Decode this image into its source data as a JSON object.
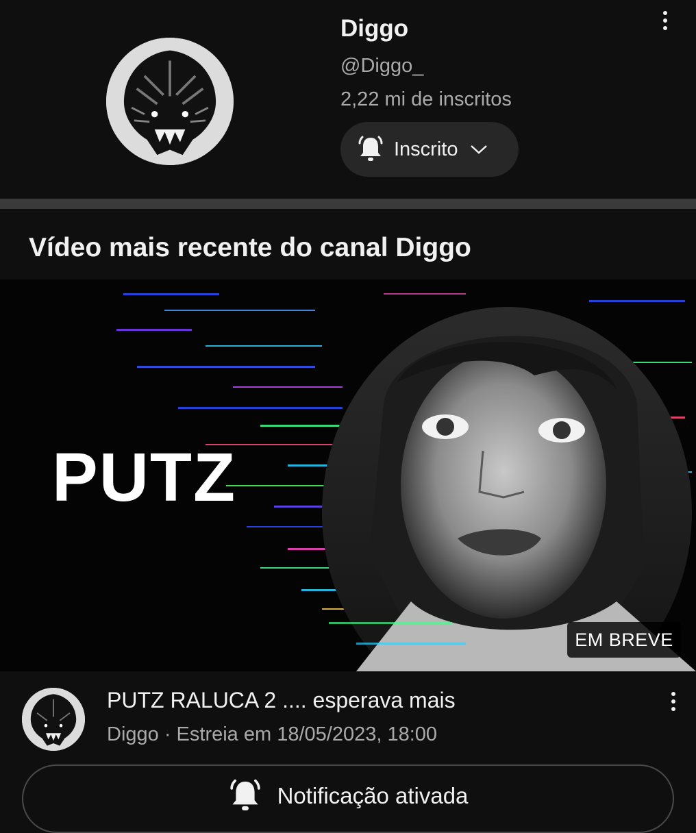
{
  "channel": {
    "name": "Diggo",
    "handle": "@Diggo_",
    "subscribers": "2,22 mi de inscritos",
    "subscribe_button_label": "Inscrito"
  },
  "section": {
    "title": "Vídeo mais recente do canal Diggo"
  },
  "video": {
    "thumbnail_text": "PUTZ",
    "badge": "EM BREVE",
    "title": "PUTZ RALUCA 2 .... esperava mais",
    "meta": "Diggo · Estreia em 18/05/2023, 18:00",
    "notification_button_label": "Notificação ativada"
  },
  "icons": {
    "subscribe_bell": "bell-ringing-icon",
    "subscribe_chevron": "chevron-down-icon",
    "more": "more-vert-icon",
    "notification_bell": "bell-ringing-icon"
  },
  "colors": {
    "background": "#0f0f0f",
    "button_bg": "#272727",
    "secondary_text": "#aaaaaa",
    "separator": "#3a3a3a"
  }
}
